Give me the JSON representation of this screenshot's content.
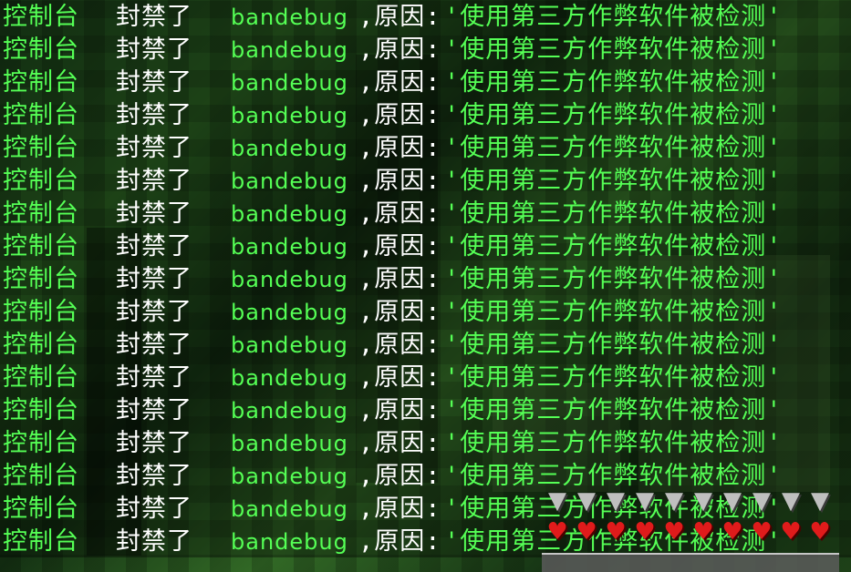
{
  "chat": {
    "lines": [
      {
        "console": "控制台",
        "banned": "封禁了",
        "player": "bandebug",
        "reason_label": ",原因:",
        "reason": "'使用第三方作弊软件被检测'"
      },
      {
        "console": "控制台",
        "banned": "封禁了",
        "player": "bandebug",
        "reason_label": ",原因:",
        "reason": "'使用第三方作弊软件被检测'"
      },
      {
        "console": "控制台",
        "banned": "封禁了",
        "player": "bandebug",
        "reason_label": ",原因:",
        "reason": "'使用第三方作弊软件被检测'"
      },
      {
        "console": "控制台",
        "banned": "封禁了",
        "player": "bandebug",
        "reason_label": ",原因:",
        "reason": "'使用第三方作弊软件被检测'"
      },
      {
        "console": "控制台",
        "banned": "封禁了",
        "player": "bandebug",
        "reason_label": ",原因:",
        "reason": "'使用第三方作弊软件被检测'"
      },
      {
        "console": "控制台",
        "banned": "封禁了",
        "player": "bandebug",
        "reason_label": ",原因:",
        "reason": "'使用第三方作弊软件被检测'"
      },
      {
        "console": "控制台",
        "banned": "封禁了",
        "player": "bandebug",
        "reason_label": ",原因:",
        "reason": "'使用第三方作弊软件被检测'"
      },
      {
        "console": "控制台",
        "banned": "封禁了",
        "player": "bandebug",
        "reason_label": ",原因:",
        "reason": "'使用第三方作弊软件被检测'"
      },
      {
        "console": "控制台",
        "banned": "封禁了",
        "player": "bandebug",
        "reason_label": ",原因:",
        "reason": "'使用第三方作弊软件被检测'"
      },
      {
        "console": "控制台",
        "banned": "封禁了",
        "player": "bandebug",
        "reason_label": ",原因:",
        "reason": "'使用第三方作弊软件被检测'"
      },
      {
        "console": "控制台",
        "banned": "封禁了",
        "player": "bandebug",
        "reason_label": ",原因:",
        "reason": "'使用第三方作弊软件被检测'"
      },
      {
        "console": "控制台",
        "banned": "封禁了",
        "player": "bandebug",
        "reason_label": ",原因:",
        "reason": "'使用第三方作弊软件被检测'"
      },
      {
        "console": "控制台",
        "banned": "封禁了",
        "player": "bandebug",
        "reason_label": ",原因:",
        "reason": "'使用第三方作弊软件被检测'"
      },
      {
        "console": "控制台",
        "banned": "封禁了",
        "player": "bandebug",
        "reason_label": ",原因:",
        "reason": "'使用第三方作弊软件被检测'"
      },
      {
        "console": "控制台",
        "banned": "封禁了",
        "player": "bandebug",
        "reason_label": ",原因:",
        "reason": "'使用第三方作弊软件被检测'"
      },
      {
        "console": "控制台",
        "banned": "封禁了",
        "player": "bandebug",
        "reason_label": ",原因:",
        "reason": "'使用第三方作弊软件被检测'"
      },
      {
        "console": "控制台",
        "banned": "封禁了",
        "player": "bandebug",
        "reason_label": ",原因:",
        "reason": "'使用第三方作弊软件被检测'"
      }
    ]
  },
  "hud": {
    "armor_icon": "chestplate-icon",
    "armor_points": 10,
    "health_icon": "heart-icon",
    "health_hearts": 10
  },
  "colors": {
    "chat_green": "#55ff55",
    "chat_white": "#ffffff",
    "heart_red": "#e01b1b",
    "armor_gray": "#bfbfbf"
  }
}
